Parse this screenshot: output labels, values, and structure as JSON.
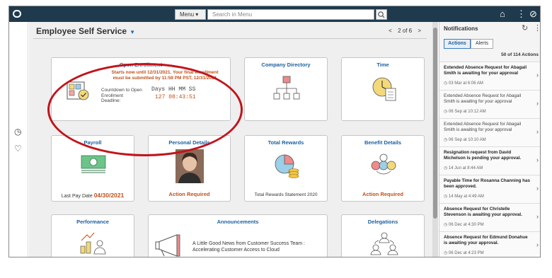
{
  "topbar": {
    "menu_label": "Menu ▾",
    "search_placeholder": "Search in Menu"
  },
  "main": {
    "page_title": "Employee Self Service",
    "pager": {
      "prev": "<",
      "label": "2 of 6",
      "next": ">"
    }
  },
  "tiles": {
    "open_enrollment": {
      "title": "Open Enrollment",
      "notice_line1": "Starts now until 12/31/2021. Your final enrollment",
      "notice_line2": "must be submitted by 11:59 PM PST, 12/31/2021",
      "countdown_label_line1": "Countdown to Open",
      "countdown_label_line2": "Enrollment",
      "countdown_label_line3": "Deadline:",
      "countdown_header": "Days HH MM SS",
      "countdown_value": "127 08:43:51"
    },
    "company_directory": {
      "title": "Company Directory"
    },
    "time": {
      "title": "Time"
    },
    "payroll": {
      "title": "Payroll",
      "foot_label": "Last Pay Date",
      "foot_value": "04/30/2021"
    },
    "personal_details": {
      "title": "Personal Details",
      "foot": "Action Required"
    },
    "total_rewards": {
      "title": "Total Rewards",
      "foot": "Total Rewards Statement 2020"
    },
    "benefit_details": {
      "title": "Benefit Details",
      "foot": "Action Required"
    },
    "performance": {
      "title": "Performance"
    },
    "announcements": {
      "title": "Announcements",
      "line1": "A Little Good News from Customer Success Team :",
      "line2": "Accelerating Customer Access to Cloud"
    },
    "delegations": {
      "title": "Delegations"
    }
  },
  "notifications": {
    "title": "Notifications",
    "tabs": [
      "Actions",
      "Alerts"
    ],
    "count": "50 of 114 Actions",
    "items": [
      {
        "text": "Extended Absence Request for Abagail Smith is awaiting for your approval",
        "date": "03 Mar at 6:06 AM",
        "bold": true
      },
      {
        "text": "Extended Absence Request for Abagail Smith is awaiting for your approval",
        "date": "06 Sep at 10:12 AM",
        "bold": false
      },
      {
        "text": "Extended Absence Request for Abagail Smith is awaiting for your approval",
        "date": "06 Sep at 10:10 AM",
        "bold": false
      },
      {
        "text": "Resignation request from David Michelson is pending your approval.",
        "date": "14 Jun at 8:44 AM",
        "bold": true
      },
      {
        "text": "Payable Time for Rosanna Channing has been approved.",
        "date": "14 May at 4:49 AM",
        "bold": true
      },
      {
        "text": "Absence Request for Christelle Stevenson is awaiting your approval.",
        "date": "06 Dec at 4:30 PM",
        "bold": true
      },
      {
        "text": "Absence Request for Edmund Donahue is awaiting your approval.",
        "date": "06 Dec at 4:23 PM",
        "bold": true
      }
    ]
  },
  "colors": {
    "topbar": "#1f3a4d",
    "link_blue": "#1a5f9e",
    "alert_orange": "#c0511a",
    "annotation_red": "#c1141c"
  }
}
